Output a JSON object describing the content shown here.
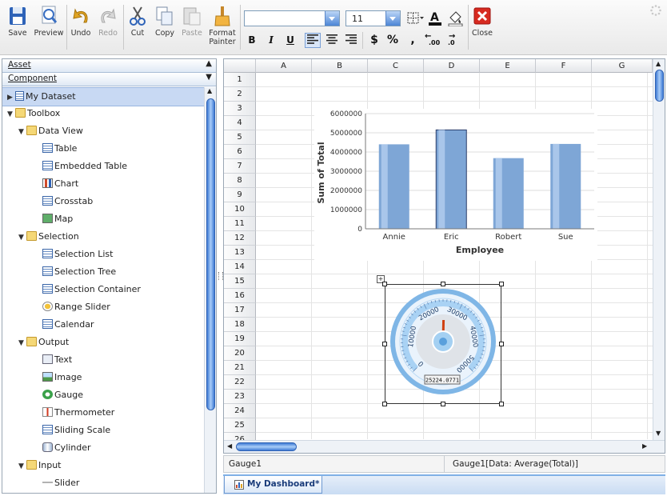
{
  "toolbar": {
    "buttons": [
      {
        "label": "Save",
        "icon": "save-icon"
      },
      {
        "label": "Preview",
        "icon": "preview-icon"
      },
      {
        "label": "Undo",
        "icon": "undo-icon"
      },
      {
        "label": "Redo",
        "icon": "redo-icon",
        "disabled": true
      },
      {
        "label": "Cut",
        "icon": "scissors-icon"
      },
      {
        "label": "Copy",
        "icon": "copy-icon"
      },
      {
        "label": "Paste",
        "icon": "paste-icon",
        "disabled": true
      },
      {
        "label_line1": "Format",
        "label_line2": "Painter",
        "icon": "format-painter-icon"
      },
      {
        "label": "Close",
        "icon": "close-icon"
      }
    ],
    "font_name_value": "",
    "font_size_value": "11",
    "bold": "B",
    "italic": "I",
    "underline": "U",
    "dollar": "$",
    "percent": "%",
    "comma": ",",
    "inc_decimal": ".00",
    "dec_decimal": ".0"
  },
  "left_panel": {
    "asset_label": "Asset",
    "component_label": "Component",
    "tree": [
      {
        "label": "My Dataset",
        "level": 0,
        "icon": "dataset-icon",
        "arrow": "▶",
        "selected": true
      },
      {
        "label": "Toolbox",
        "level": 0,
        "icon": "folder-icon",
        "arrow": "▼"
      },
      {
        "label": "Data View",
        "level": 1,
        "icon": "folder-icon",
        "arrow": "▼"
      },
      {
        "label": "Table",
        "level": 2,
        "icon": "table-icon"
      },
      {
        "label": "Embedded Table",
        "level": 2,
        "icon": "embedded-table-icon"
      },
      {
        "label": "Chart",
        "level": 2,
        "icon": "chart-icon"
      },
      {
        "label": "Crosstab",
        "level": 2,
        "icon": "crosstab-icon"
      },
      {
        "label": "Map",
        "level": 2,
        "icon": "map-icon"
      },
      {
        "label": "Selection",
        "level": 1,
        "icon": "folder-icon",
        "arrow": "▼"
      },
      {
        "label": "Selection List",
        "level": 2,
        "icon": "selection-list-icon"
      },
      {
        "label": "Selection Tree",
        "level": 2,
        "icon": "selection-tree-icon"
      },
      {
        "label": "Selection Container",
        "level": 2,
        "icon": "selection-container-icon"
      },
      {
        "label": "Range Slider",
        "level": 2,
        "icon": "range-slider-icon"
      },
      {
        "label": "Calendar",
        "level": 2,
        "icon": "calendar-icon"
      },
      {
        "label": "Output",
        "level": 1,
        "icon": "folder-icon",
        "arrow": "▼"
      },
      {
        "label": "Text",
        "level": 2,
        "icon": "text-icon"
      },
      {
        "label": "Image",
        "level": 2,
        "icon": "image-icon"
      },
      {
        "label": "Gauge",
        "level": 2,
        "icon": "gauge-icon"
      },
      {
        "label": "Thermometer",
        "level": 2,
        "icon": "thermometer-icon"
      },
      {
        "label": "Sliding Scale",
        "level": 2,
        "icon": "sliding-scale-icon"
      },
      {
        "label": "Cylinder",
        "level": 2,
        "icon": "cylinder-icon"
      },
      {
        "label": "Input",
        "level": 1,
        "icon": "folder-icon",
        "arrow": "▼"
      },
      {
        "label": "Slider",
        "level": 2,
        "icon": "slider-icon"
      }
    ]
  },
  "sheet": {
    "columns": [
      "A",
      "B",
      "C",
      "D",
      "E",
      "F",
      "G"
    ],
    "rows": [
      "1",
      "2",
      "3",
      "4",
      "5",
      "6",
      "7",
      "8",
      "9",
      "10",
      "11",
      "12",
      "13",
      "14",
      "15",
      "16",
      "17",
      "18",
      "19",
      "20",
      "21",
      "22",
      "23",
      "24",
      "25",
      "26"
    ]
  },
  "chart_data": {
    "type": "bar",
    "categories": [
      "Annie",
      "Eric",
      "Robert",
      "Sue"
    ],
    "values": [
      4400000,
      5150000,
      3680000,
      4420000
    ],
    "xlabel": "Employee",
    "ylabel": "Sum of Total",
    "ylim": [
      0,
      6000000
    ],
    "yticks": [
      "0",
      "1000000",
      "2000000",
      "3000000",
      "4000000",
      "5000000",
      "6000000"
    ],
    "bar_color": "#7ea6d6",
    "selected_bar": "Eric"
  },
  "gauge": {
    "ticks": [
      "0",
      "10000",
      "20000",
      "30000",
      "40000",
      "50000"
    ],
    "value": 25224.0771,
    "readout": "25224.0771",
    "max": 50000,
    "needle_color": "#d04010"
  },
  "status": {
    "left": "Gauge1",
    "right": "Gauge1[Data: Average(Total)]"
  },
  "tabs": [
    {
      "label": "My Dashboard*"
    }
  ]
}
